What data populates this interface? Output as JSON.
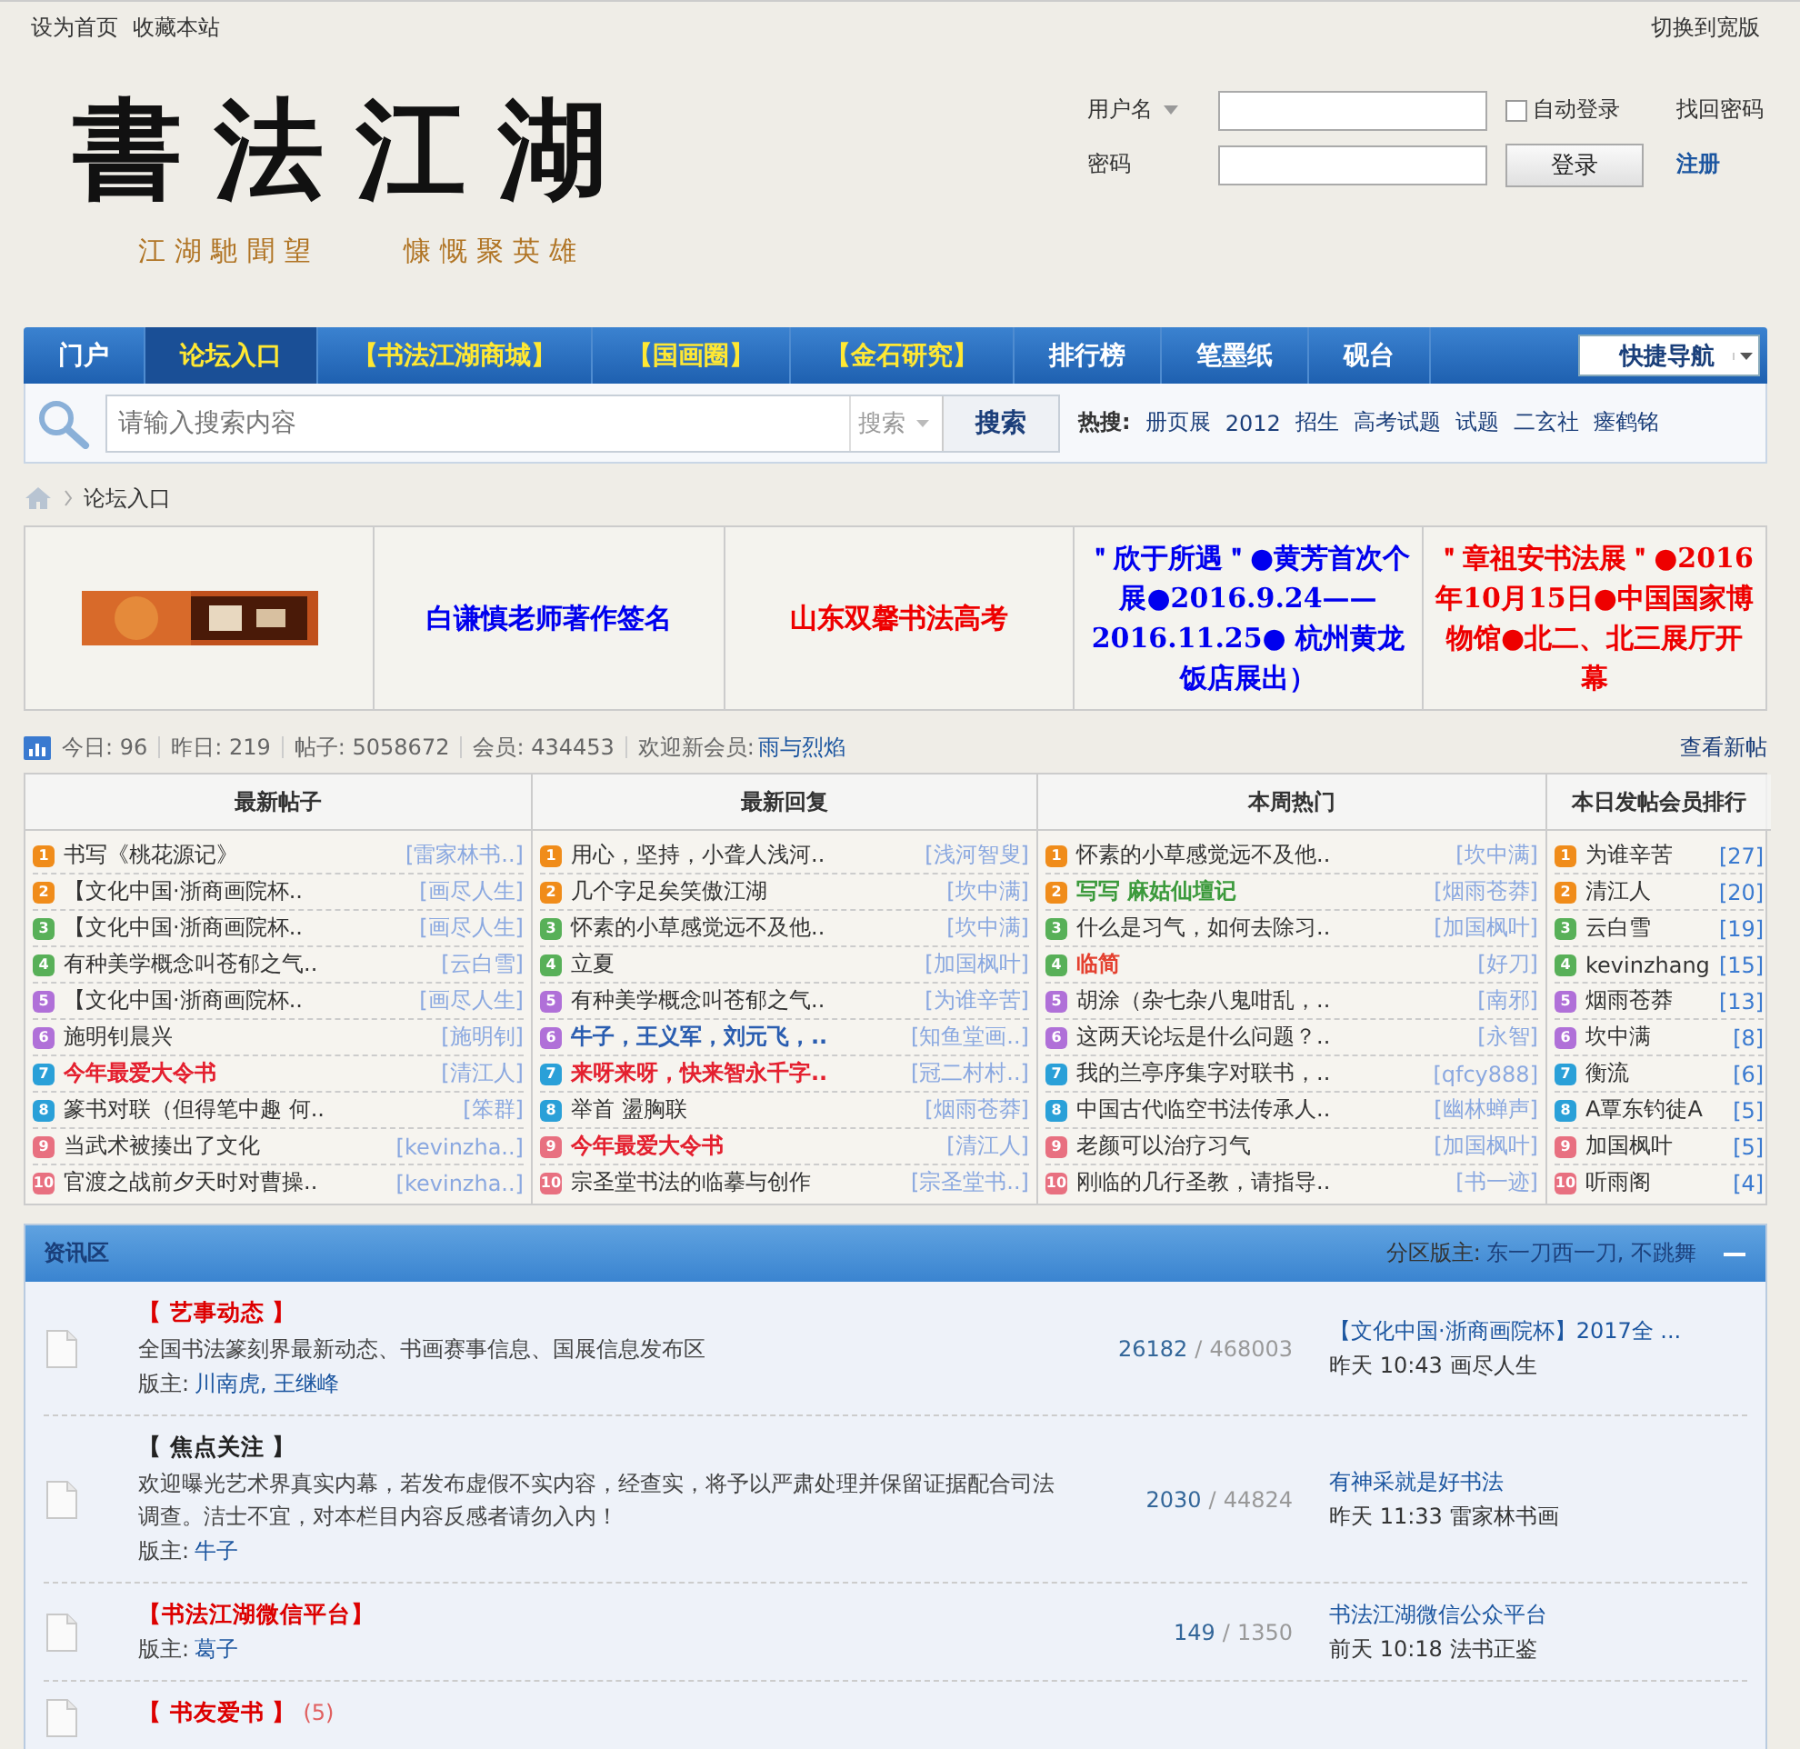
{
  "top_bar": {
    "left_links": [
      "设为首页",
      "收藏本站"
    ],
    "right_link": "切换到宽版"
  },
  "header": {
    "logo": "書法江湖",
    "slogans": [
      "江湖馳聞望",
      "慷慨聚英雄"
    ]
  },
  "login": {
    "username_label": "用户名",
    "password_label": "密码",
    "auto_login": {
      "label": "自动登录",
      "checked": false
    },
    "forgot": "找回密码",
    "button": "登录",
    "register": "注册"
  },
  "nav": {
    "items": [
      {
        "label": "门户",
        "selected": false,
        "emphasis": false
      },
      {
        "label": "论坛入口",
        "selected": true,
        "emphasis": true
      },
      {
        "label": "【书法江湖商城】",
        "selected": false,
        "emphasis": true
      },
      {
        "label": "【国画圈】",
        "selected": false,
        "emphasis": true
      },
      {
        "label": "【金石研究】",
        "selected": false,
        "emphasis": true
      },
      {
        "label": "排行榜",
        "selected": false,
        "emphasis": false
      },
      {
        "label": "笔墨纸",
        "selected": false,
        "emphasis": false
      },
      {
        "label": "砚台",
        "selected": false,
        "emphasis": false
      }
    ],
    "quick_nav": "快捷导航"
  },
  "search": {
    "placeholder": "请输入搜索内容",
    "scope": "搜索",
    "button": "搜索",
    "hot_label": "热搜:",
    "hot": [
      "册页展",
      "2012",
      "招生",
      "高考试题",
      "试题",
      "二玄社",
      "瘗鹤铭"
    ]
  },
  "breadcrumb": {
    "current": "论坛入口"
  },
  "banners": [
    {
      "kind": "picture"
    },
    {
      "kind": "text",
      "text": "白谦慎老师著作签名",
      "color": "#0000ee"
    },
    {
      "kind": "text",
      "text": "山东双馨书法高考",
      "color": "#ee0000"
    },
    {
      "kind": "text",
      "text": "＂欣于所遇＂●黄芳首次个展●2016.9.24——2016.11.25● 杭州黄龙饭店展出）",
      "color": "#0000ee"
    },
    {
      "kind": "text",
      "text": "＂章祖安书法展＂●2016年10月15日●中国国家博物馆●北二、北三展厅开幕",
      "color": "#ee0000"
    }
  ],
  "stats": {
    "items": [
      "今日: 96",
      "昨日: 219",
      "帖子: 5058672",
      "会员: 434453"
    ],
    "welcome": "欢迎新会员:",
    "new_member": "雨与烈焰",
    "new_posts_link": "查看新帖"
  },
  "lists": [
    {
      "heading": "最新帖子",
      "rows": [
        {
          "rank": "1",
          "title": "书写《桃花源记》",
          "author": "[雷家林书..]"
        },
        {
          "rank": "2",
          "title": "【文化中国·浙商画院杯..",
          "author": "[画尽人生]"
        },
        {
          "rank": "3",
          "title": "【文化中国·浙商画院杯..",
          "author": "[画尽人生]"
        },
        {
          "rank": "4",
          "title": "有种美学概念叫苍郁之气..",
          "author": "[云白雪]"
        },
        {
          "rank": "5",
          "title": "【文化中国·浙商画院杯..",
          "author": "[画尽人生]"
        },
        {
          "rank": "6",
          "title": "施明钊晨兴",
          "author": "[施明钊]"
        },
        {
          "rank": "7",
          "title": "今年最爱大令书",
          "author": "[清江人]",
          "color": "#e4202f"
        },
        {
          "rank": "8",
          "title": "篆书对联（但得笔中趣 何..",
          "author": "[笨群]"
        },
        {
          "rank": "9",
          "title": "当武术被揍出了文化",
          "author": "[kevinzha..]"
        },
        {
          "rank": "10",
          "title": "官渡之战前夕天时对曹操..",
          "author": "[kevinzha..]"
        }
      ]
    },
    {
      "heading": "最新回复",
      "rows": [
        {
          "rank": "1",
          "title": "用心，坚持，小聋人浅河..",
          "author": "[浅河智叟]"
        },
        {
          "rank": "2",
          "title": "几个字足矣笑傲江湖",
          "author": "[坎中满]"
        },
        {
          "rank": "3",
          "title": "怀素的小草感觉远不及他..",
          "author": "[坎中满]"
        },
        {
          "rank": "4",
          "title": "立夏",
          "author": "[加国枫叶]"
        },
        {
          "rank": "5",
          "title": "有种美学概念叫苍郁之气..",
          "author": "[为谁辛苦]"
        },
        {
          "rank": "6",
          "title": "牛子，王义军，刘元飞，..",
          "author": "[知鱼堂画..]",
          "color": "#2a5db0"
        },
        {
          "rank": "7",
          "title": "来呀来呀，快来智永千字..",
          "author": "[冠二村村..]",
          "color": "#e4202f"
        },
        {
          "rank": "8",
          "title": "举首 盪胸联",
          "author": "[烟雨苍莽]"
        },
        {
          "rank": "9",
          "title": "今年最爱大令书",
          "author": "[清江人]",
          "color": "#e4202f"
        },
        {
          "rank": "10",
          "title": "宗圣堂书法的临摹与创作",
          "author": "[宗圣堂书..]"
        }
      ]
    },
    {
      "heading": "本周热门",
      "rows": [
        {
          "rank": "1",
          "title": "怀素的小草感觉远不及他..",
          "author": "[坎中满]"
        },
        {
          "rank": "2",
          "title": "写写 麻姑仙壇记",
          "author": "[烟雨苍莽]",
          "color": "#3c9a3c"
        },
        {
          "rank": "3",
          "title": "什么是习气，如何去除习..",
          "author": "[加国枫叶]"
        },
        {
          "rank": "4",
          "title": "临简",
          "author": "[好刀]",
          "color": "#e4402f"
        },
        {
          "rank": "5",
          "title": "胡涂（杂七杂八鬼咁乱，..",
          "author": "[南邪]"
        },
        {
          "rank": "6",
          "title": "这两天论坛是什么问题？..",
          "author": "[永智]"
        },
        {
          "rank": "7",
          "title": "我的兰亭序集字对联书，..",
          "author": "[qfcy888]"
        },
        {
          "rank": "8",
          "title": "中国古代临空书法传承人..",
          "author": "[幽林蝉声]"
        },
        {
          "rank": "9",
          "title": "老颜可以治疗习气",
          "author": "[加国枫叶]"
        },
        {
          "rank": "10",
          "title": "刚临的几行圣教，请指导..",
          "author": "[书一迹]"
        }
      ]
    },
    {
      "heading": "本日发帖会员排行",
      "rows": [
        {
          "rank": "1",
          "title": "为谁辛苦",
          "author": "[27]"
        },
        {
          "rank": "2",
          "title": "清江人",
          "author": "[20]"
        },
        {
          "rank": "3",
          "title": "云白雪",
          "author": "[19]"
        },
        {
          "rank": "4",
          "title": "kevinzhang",
          "author": "[15]"
        },
        {
          "rank": "5",
          "title": "烟雨苍莽",
          "author": "[13]"
        },
        {
          "rank": "6",
          "title": "坎中满",
          "author": "[8]"
        },
        {
          "rank": "7",
          "title": "衡流",
          "author": "[6]"
        },
        {
          "rank": "8",
          "title": "A覃东钓徒A",
          "author": "[5]"
        },
        {
          "rank": "9",
          "title": "加国枫叶",
          "author": "[5]"
        },
        {
          "rank": "10",
          "title": "听雨阁",
          "author": "[4]"
        }
      ]
    }
  ],
  "section": {
    "title": "资讯区",
    "moderators_label": "分区版主:",
    "moderators": "东一刀西一刀, 不跳舞",
    "count_separator": "/",
    "forums": [
      {
        "name": "【 艺事动态 】",
        "color": "#dd0000",
        "description": "全国书法篆刻界最新动态、书画赛事信息、国展信息发布区",
        "mods_label": "版主:",
        "mods": "川南虎, 王继峰",
        "threads": "26182",
        "posts": "468003",
        "last_title": "【文化中国·浙商画院杯】2017全 ...",
        "last_time": "昨天 10:43",
        "last_user": "画尽人生"
      },
      {
        "name": "【 焦点关注 】",
        "color": "#222222",
        "description": "欢迎曝光艺术界真实内幕，若发布虚假不实内容，经查实，将予以严肃处理并保留证据配合司法调查。洁士不宜，对本栏目内容反感者请勿入内！",
        "mods_label": "版主:",
        "mods": "牛子",
        "threads": "2030",
        "posts": "44824",
        "last_title": "有神采就是好书法",
        "last_time": "昨天 11:33",
        "last_user": "雷家林书画"
      },
      {
        "name": "【书法江湖微信平台】",
        "color": "#dd0000",
        "mods_label": "版主:",
        "mods": "葛子",
        "threads": "149",
        "posts": "1350",
        "last_title": "书法江湖微信公众平台",
        "last_time": "前天 10:18",
        "last_user": "法书正鉴"
      },
      {
        "name": "【 书友爱书 】",
        "color": "#dd0000",
        "today": "(5)"
      }
    ]
  }
}
